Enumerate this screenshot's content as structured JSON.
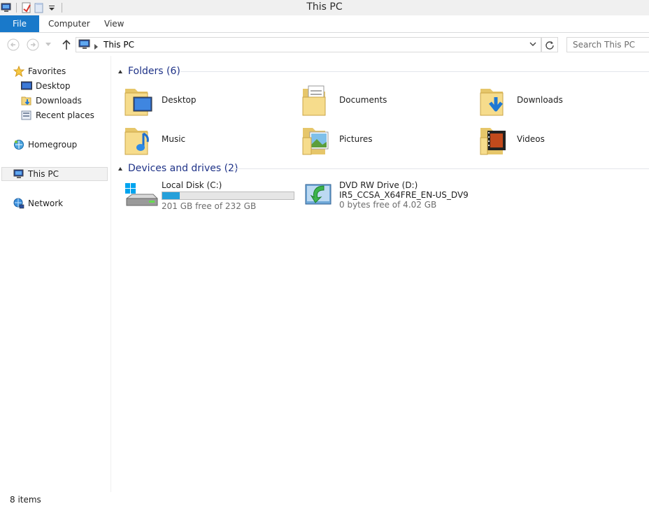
{
  "window": {
    "title": "This PC"
  },
  "ribbon": {
    "tabs": [
      "File",
      "Computer",
      "View"
    ]
  },
  "address": {
    "path": "This PC",
    "search_placeholder": "Search This PC"
  },
  "navpane": {
    "favorites": {
      "label": "Favorites",
      "items": [
        "Desktop",
        "Downloads",
        "Recent places"
      ]
    },
    "homegroup": "Homegroup",
    "this_pc": "This PC",
    "network": "Network"
  },
  "folders": {
    "header": "Folders (6)",
    "items": [
      {
        "label": "Desktop",
        "icon": "folder-desktop-icon"
      },
      {
        "label": "Documents",
        "icon": "folder-documents-icon"
      },
      {
        "label": "Downloads",
        "icon": "folder-downloads-icon"
      },
      {
        "label": "Music",
        "icon": "folder-music-icon"
      },
      {
        "label": "Pictures",
        "icon": "folder-pictures-icon"
      },
      {
        "label": "Videos",
        "icon": "folder-videos-icon"
      }
    ]
  },
  "devices": {
    "header": "Devices and drives (2)",
    "items": [
      {
        "name": "Local Disk (C:)",
        "detail": "201 GB free of 232 GB",
        "used_fraction": 0.134
      },
      {
        "name": "DVD RW Drive (D:)",
        "volume": "IR5_CCSA_X64FRE_EN-US_DV9",
        "detail": "0 bytes free of 4.02 GB"
      }
    ]
  },
  "status": {
    "items": "8 items"
  },
  "colors": {
    "accent": "#1979ca",
    "group_header": "#1e3287",
    "progress": "#26a0da"
  }
}
